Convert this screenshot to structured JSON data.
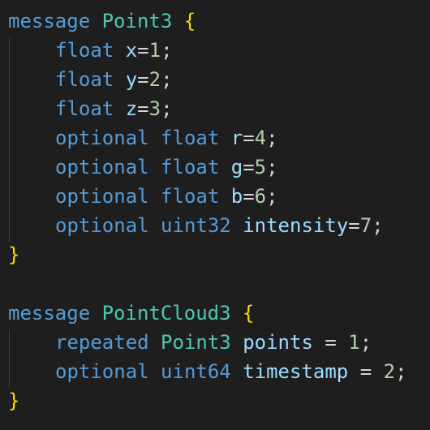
{
  "colors": {
    "background": "#1e1e1e",
    "keyword": "#569cd6",
    "type": "#4ec9b0",
    "identifier": "#9cdcfe",
    "number": "#b5cea8",
    "operator": "#d4d4d4",
    "brace": "#ffd700",
    "indent_guide": "#404040"
  },
  "code": {
    "msg1": {
      "keyword": "message",
      "name": "Point3",
      "open": "{",
      "close": "}",
      "fields": [
        {
          "modifier": "",
          "type": "float",
          "name": "x",
          "eq": "=",
          "num": "1",
          "semi": ";"
        },
        {
          "modifier": "",
          "type": "float",
          "name": "y",
          "eq": "=",
          "num": "2",
          "semi": ";"
        },
        {
          "modifier": "",
          "type": "float",
          "name": "z",
          "eq": "=",
          "num": "3",
          "semi": ";"
        },
        {
          "modifier": "optional",
          "type": "float",
          "name": "r",
          "eq": "=",
          "num": "4",
          "semi": ";"
        },
        {
          "modifier": "optional",
          "type": "float",
          "name": "g",
          "eq": "=",
          "num": "5",
          "semi": ";"
        },
        {
          "modifier": "optional",
          "type": "float",
          "name": "b",
          "eq": "=",
          "num": "6",
          "semi": ";"
        },
        {
          "modifier": "optional",
          "type": "uint32",
          "name": "intensity",
          "eq": "=",
          "num": "7",
          "semi": ";"
        }
      ]
    },
    "msg2": {
      "keyword": "message",
      "name": "PointCloud3",
      "open": "{",
      "close": "}",
      "fields": [
        {
          "modifier": "repeated",
          "type": "Point3",
          "name": "points",
          "eq": " = ",
          "num": "1",
          "semi": ";"
        },
        {
          "modifier": "optional",
          "type": "uint64",
          "name": "timestamp",
          "eq": " = ",
          "num": "2",
          "semi": ";"
        }
      ]
    }
  }
}
